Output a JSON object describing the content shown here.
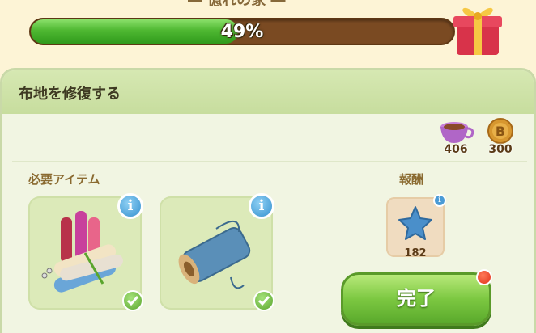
{
  "top": {
    "title_fragment": "― 憶れの家 ―",
    "progress_percent": 49,
    "progress_label": "49%"
  },
  "panel": {
    "title": "布地を修復する"
  },
  "currencies": [
    {
      "icon": "cup-icon",
      "value": "406"
    },
    {
      "icon": "coin-icon",
      "value": "300"
    }
  ],
  "required_items": {
    "label": "必要アイテム",
    "items": [
      {
        "icon": "fabric-rolls-icon",
        "info": "i",
        "status": "complete"
      },
      {
        "icon": "thread-spool-icon",
        "info": "i",
        "status": "complete"
      }
    ]
  },
  "reward": {
    "label": "報酬",
    "icon": "star-icon",
    "value": "182",
    "info": "i"
  },
  "complete_button": {
    "label": "完了"
  },
  "colors": {
    "progress_fill": "#4fb832",
    "progress_track": "#7a4a22",
    "panel_bg": "#f1f5e2",
    "button_green": "#7cc841",
    "notify_red": "#e0321a"
  }
}
